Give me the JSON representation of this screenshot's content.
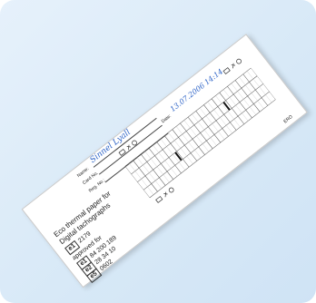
{
  "paper": {
    "title_line1": "Eco thermal paper for",
    "title_line2": "Digital tachographs",
    "code_box": "e1",
    "code_value": "2179",
    "approved_for": "approved for",
    "approvals": [
      {
        "box": "e1",
        "value": "84 200 189"
      },
      {
        "box": "e2",
        "value": "28 34 10"
      },
      {
        "box": "e5",
        "value": "0602"
      }
    ],
    "footer_mark": "ERO",
    "field_name_label": "Name:",
    "field_name_value": "Sinnel Lyall",
    "field_card_label": "Card No.",
    "field_date_label": "Date:",
    "field_date_value": "13.07.2006",
    "field_date_extra": "14:14",
    "field_reg_label": "Reg. No.:"
  },
  "colors": {
    "ink": "#222222",
    "handwriting": "#2e64c7",
    "paper": "#ffffff",
    "background": "#dcebf8"
  },
  "icons": [
    "rest-bed-icon",
    "hammer-icon",
    "steering-wheel-icon",
    "card-icon",
    "vehicle-icon"
  ]
}
